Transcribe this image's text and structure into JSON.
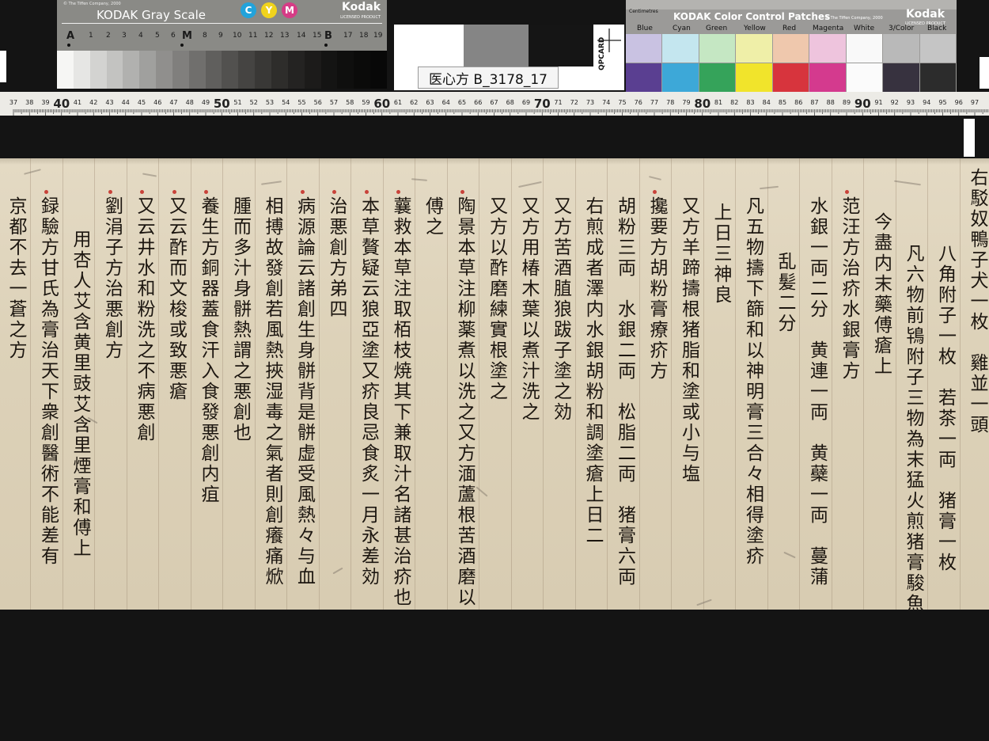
{
  "gray_target": {
    "copyright": "© The Tiffen Company, 2000",
    "title": "KODAK Gray Scale",
    "cym": [
      "C",
      "Y",
      "M"
    ],
    "cym_colors": [
      "#22a3db",
      "#f0d31c",
      "#d63c86"
    ],
    "brand": "Kodak",
    "brand_sub": "LICENSED PRODUCT",
    "scale_labels": [
      "A",
      "1",
      "2",
      "3",
      "4",
      "5",
      "6",
      "M",
      "8",
      "9",
      "10",
      "11",
      "12",
      "13",
      "14",
      "15",
      "B",
      "17",
      "18",
      "19"
    ],
    "gray_steps": [
      "#f6f6f4",
      "#e6e6e4",
      "#d3d3d1",
      "#c3c3c1",
      "#b1b1af",
      "#a0a09e",
      "#908f8d",
      "#807f7d",
      "#706f6d",
      "#605f5d",
      "#52514f",
      "#454442",
      "#393836",
      "#2e2d2b",
      "#242322",
      "#1c1b1a",
      "#141413",
      "#0f0f0e",
      "#0b0b0a",
      "#080808"
    ]
  },
  "qp_card": {
    "label": "医心方 B_3178_17",
    "brand": "QPCARD"
  },
  "color_target": {
    "units": "Centimetres",
    "title": "KODAK Color Control Patches",
    "copyright": "© The Tiffen Company, 2000",
    "brand": "Kodak",
    "brand_sub": "LICENSED PRODUCT",
    "patch_names": [
      "Blue",
      "Cyan",
      "Green",
      "Yellow",
      "Red",
      "Magenta",
      "White",
      "3/Color",
      "Black"
    ],
    "row1": [
      "#c9c2e2",
      "#c4e6ef",
      "#c5e7c3",
      "#efefa8",
      "#efc8ad",
      "#eec4dd",
      "#f9f9f9",
      "#b9b9b9",
      "#c5c5c5"
    ],
    "row2": [
      "#5a3f91",
      "#3da8d8",
      "#35a35a",
      "#f1e42b",
      "#d7343d",
      "#d43a8e",
      "#fbfbfb",
      "#37323f",
      "#2c2c2c"
    ]
  },
  "ruler": {
    "start": 37,
    "end": 97
  },
  "manuscript": {
    "columns": [
      "右駁奴鴨子犬一枚　雞並一頭",
      "八角附子一枚　若茶一両　猪膏一枚",
      "凡六物前鴇附子三物為末猛火煎猪膏駿魚",
      "今盡内末藥傅瘡上",
      "范汪方治疥水銀膏方",
      "水銀一両二分　黄連一両　黄蘗一両　蔓蒲",
      "乱髪二分",
      "凡五物擣下篩和以神明膏三合々相得塗疥",
      "上日三神良",
      "又方羊蹄擣根猪脂和塗或小与塩",
      "攙要方胡粉膏療疥方",
      "胡粉三両　水銀二両　松脂二両　猪膏六両",
      "右煎成者澤内水銀胡粉和調塗瘡上日二",
      "又方苦酒䐈狼跋子塗之効",
      "又方用椿木葉以煮汁洗之",
      "又方以酢磨練實根塗之",
      "陶景本草注柳薬煮以洗之又方湎蘆根苦酒磨以",
      "傅之",
      "蘘救本草注取栢枝焼其下兼取汁名諸甚治疥也",
      "本草贅疑云狼亞塗又疥良忌食炙一月永差効",
      "治悪創方弟四",
      "病源論云諸創生身骿背是骿虚受風熱々与血",
      "相搏故發創若風熱挾湿毒之氣者則創癢痛焮",
      "腫而多汁身骿熱謂之悪創也",
      "養生方銅器蓋食汗入食發悪創内疽",
      "又云酢而文梭或致悪瘡",
      "又云井水和粉洗之不病悪創",
      "劉涓子方治悪創方",
      "用杏人艾含黄里豉艾含里煙膏和傅上",
      "録驗方甘氏為膏治天下衆創醫術不能差有",
      "京都不去一蒼之方"
    ]
  }
}
